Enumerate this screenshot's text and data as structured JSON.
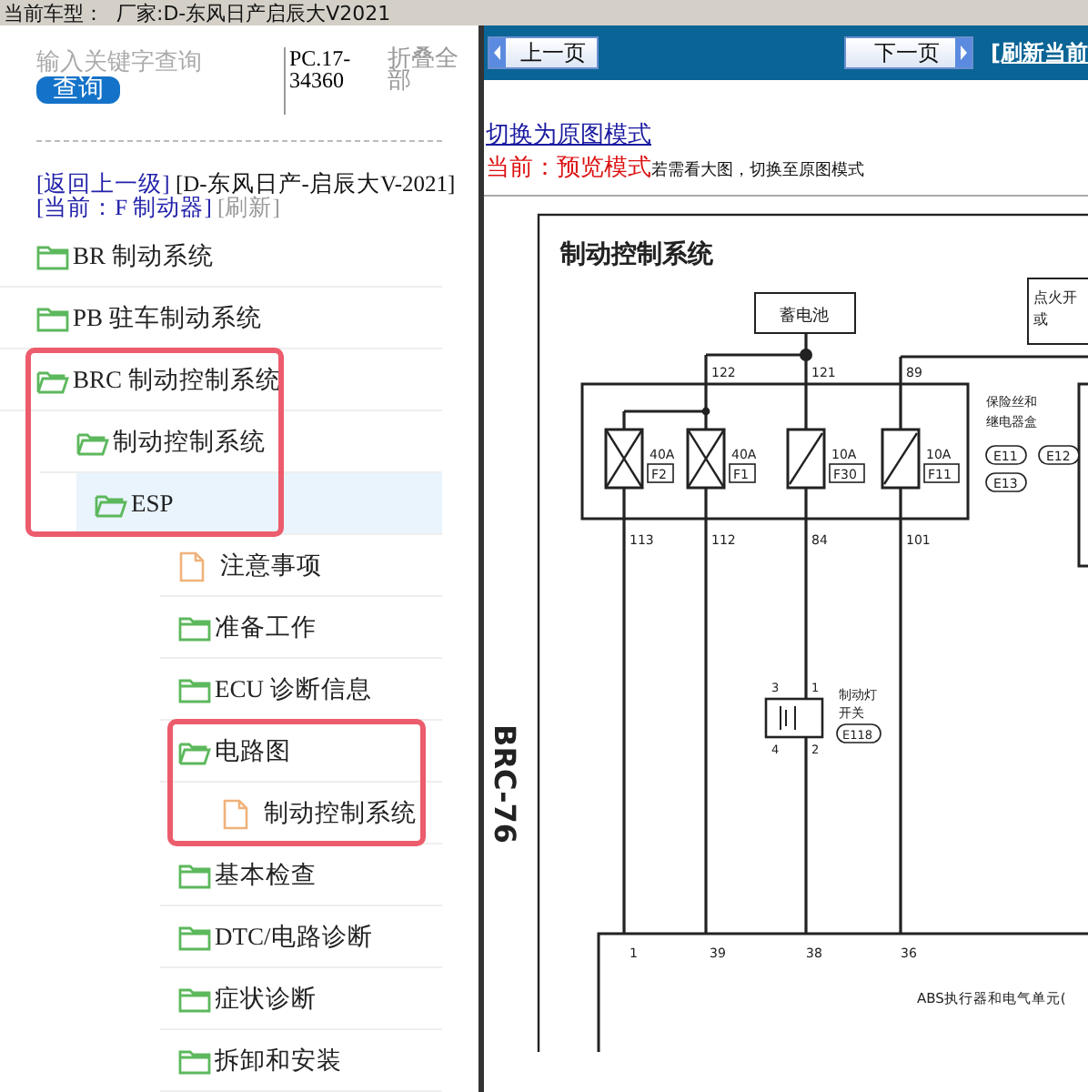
{
  "top_bar": {
    "text": "当前车型：  厂家:D-东风日产启辰大V2021"
  },
  "search": {
    "placeholder": "输入关键字查询",
    "button": "查询",
    "code": "PC.17-34360",
    "collapse": "折叠全部"
  },
  "breadcrumb": {
    "back": "[返回上一级]",
    "path": "[D-东风日产-启辰大V-2021]",
    "current": "[当前：F 制动器]",
    "refresh": "[刷新]"
  },
  "tree": [
    {
      "label": "BR 制动系统",
      "kind": "folder",
      "expanded": false,
      "selected": false
    },
    {
      "label": "PB 驻车制动系统",
      "kind": "folder",
      "expanded": false,
      "selected": false
    },
    {
      "label": "BRC 制动控制系统",
      "kind": "folder",
      "expanded": true,
      "selected": false,
      "outline_start": true,
      "children": [
        {
          "label": "制动控制系统",
          "kind": "folder",
          "expanded": true,
          "selected": false,
          "children": [
            {
              "label": "ESP",
              "kind": "folder",
              "expanded": true,
              "selected": true,
              "outline_end": true,
              "children": [
                {
                  "label": "注意事项",
                  "kind": "document",
                  "selected": false
                },
                {
                  "label": "准备工作",
                  "kind": "folder",
                  "expanded": false,
                  "selected": false
                },
                {
                  "label": "ECU 诊断信息",
                  "kind": "folder",
                  "expanded": false,
                  "selected": false
                },
                {
                  "label": "电路图",
                  "kind": "folder",
                  "expanded": true,
                  "selected": false,
                  "outline_start": true,
                  "children": [
                    {
                      "label": "制动控制系统",
                      "kind": "document",
                      "selected": false,
                      "outline_end": true
                    }
                  ]
                },
                {
                  "label": "基本检查",
                  "kind": "folder",
                  "expanded": false,
                  "selected": false
                },
                {
                  "label": "DTC/电路诊断",
                  "kind": "folder",
                  "expanded": false,
                  "selected": false
                },
                {
                  "label": "症状诊断",
                  "kind": "folder",
                  "expanded": false,
                  "selected": false
                },
                {
                  "label": "拆卸和安装",
                  "kind": "folder",
                  "expanded": false,
                  "selected": false
                }
              ]
            }
          ]
        }
      ]
    }
  ],
  "toolbar": {
    "prev": "上一页",
    "next": "下一页",
    "refresh": "[刷新当前"
  },
  "mode": {
    "link": "切换为原图模式",
    "current": "当前：",
    "mode": "预览模式",
    "hint": "若需看大图，切换至原图模式"
  },
  "diagram": {
    "title": "制动控制系统",
    "page_label": "BRC-76",
    "battery": "蓄电池",
    "ignition": [
      "点火开",
      "或"
    ],
    "top_wires": [
      "122",
      "121",
      "89"
    ],
    "fuses": [
      {
        "rating": "40A",
        "code": "F2",
        "kind": "cross"
      },
      {
        "rating": "40A",
        "code": "F1",
        "kind": "cross"
      },
      {
        "rating": "10A",
        "code": "F30",
        "kind": "slash"
      },
      {
        "rating": "10A",
        "code": "F11",
        "kind": "slash"
      }
    ],
    "bottom_wires": [
      "113",
      "112",
      "84",
      "101"
    ],
    "fuse_box_label": [
      "保险丝和",
      "继电器盒"
    ],
    "fuse_box_connectors": [
      "E11",
      "E12",
      "E13"
    ],
    "switch": {
      "pins": [
        "3",
        "1",
        "4",
        "2"
      ],
      "label": [
        "制动灯",
        "开关"
      ],
      "connector": "E118"
    },
    "unit": {
      "pins": [
        "1",
        "39",
        "38",
        "36"
      ],
      "label": "ABS执行器和电气单元("
    }
  }
}
